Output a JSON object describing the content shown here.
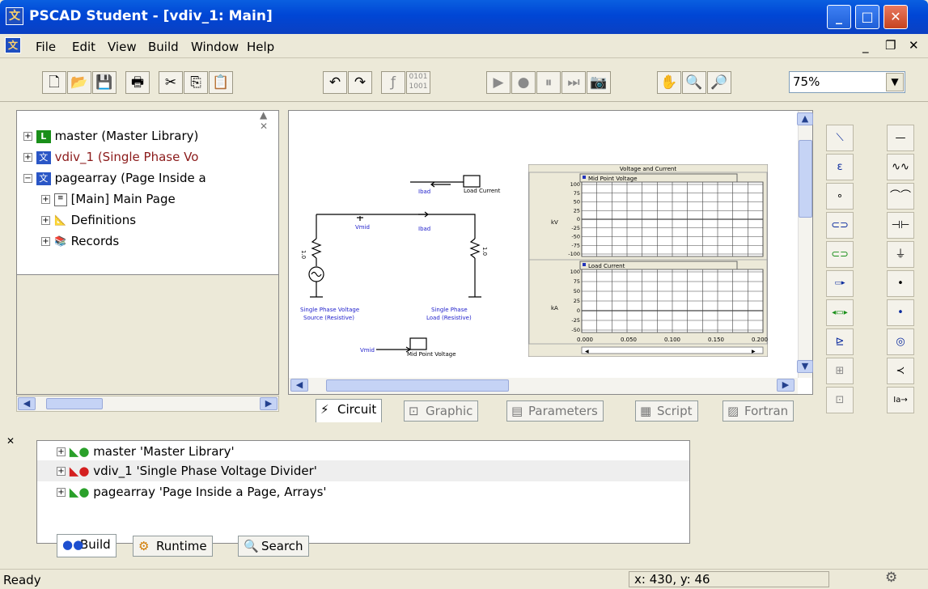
{
  "window": {
    "title": "PSCAD Student - [vdiv_1: Main]"
  },
  "menu": [
    "File",
    "Edit",
    "View",
    "Build",
    "Window",
    "Help"
  ],
  "toolbar": {
    "zoom": "75%"
  },
  "workspace_tree": [
    {
      "label": "master (Master Library)",
      "color": "#000000"
    },
    {
      "label": "vdiv_1 (Single Phase Vo",
      "color": "#8b1a1a"
    },
    {
      "label": "pagearray (Page Inside a",
      "color": "#000000"
    },
    {
      "label": "[Main] Main Page",
      "color": "#000000"
    },
    {
      "label": "Definitions",
      "color": "#000000"
    },
    {
      "label": "Records",
      "color": "#000000"
    }
  ],
  "circuit": {
    "ibad_top": "Ibad",
    "load_current_label": "Load Current",
    "vmid_label": "Vmid",
    "ibad_mid": "Ibad",
    "r1": "1.0",
    "r2": "1.0",
    "source_label": [
      "Single Phase Voltage",
      "Source (Resistive)"
    ],
    "load_label": [
      "Single Phase",
      "Load (Resistive)"
    ],
    "vmid_bottom": "Vmid",
    "mid_point_label": "Mid Point Voltage"
  },
  "graph": {
    "title": "Voltage and Current",
    "plots": [
      {
        "legend": "Mid Point Voltage",
        "ylabel": "kV",
        "yticks": [
          "100",
          "75",
          "50",
          "25",
          "0",
          "-25",
          "-50",
          "-75",
          "-100"
        ]
      },
      {
        "legend": "Load Current",
        "ylabel": "kA",
        "yticks": [
          "100",
          "75",
          "50",
          "25",
          "0",
          "-25",
          "-50"
        ]
      }
    ],
    "xticks": [
      "0.000",
      "0.050",
      "0.100",
      "0.150",
      "0.200"
    ]
  },
  "tabs": [
    "Circuit",
    "Graphic",
    "Parameters",
    "Script",
    "Fortran"
  ],
  "build_list": [
    {
      "name": "master",
      "desc": "'Master Library'",
      "flag": "#2aa02a"
    },
    {
      "name": "vdiv_1",
      "desc": "'Single Phase Voltage Divider'",
      "flag": "#d42020"
    },
    {
      "name": "pagearray",
      "desc": "'Page Inside a Page, Arrays'",
      "flag": "#2aa02a"
    }
  ],
  "bottom_tabs": [
    "Build",
    "Runtime",
    "Search"
  ],
  "status": {
    "text": "Ready",
    "coords": "x: 430, y: 46"
  }
}
